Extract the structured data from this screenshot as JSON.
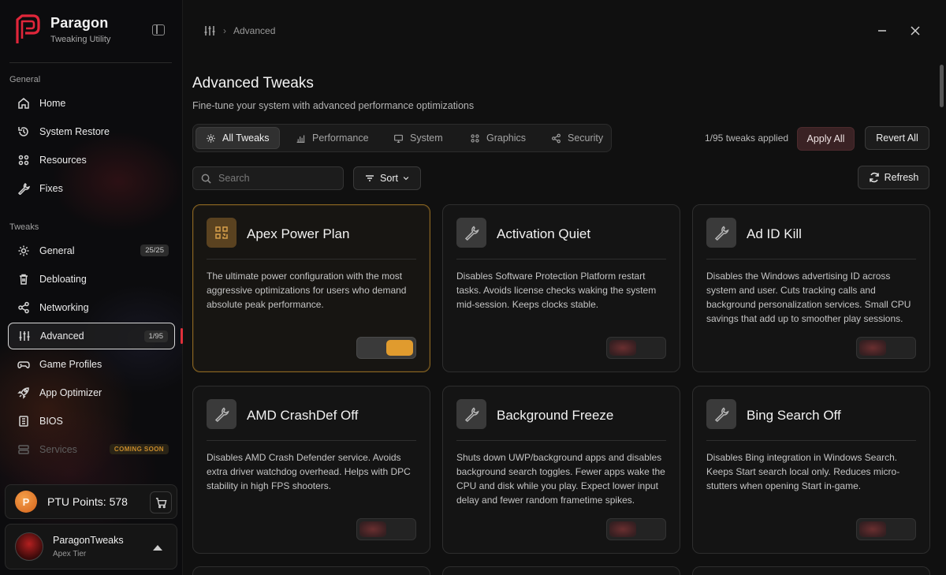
{
  "app": {
    "name": "Paragon",
    "subtitle": "Tweaking Utility"
  },
  "sidebar": {
    "section_general": "General",
    "section_tweaks": "Tweaks",
    "general_items": [
      {
        "label": "Home",
        "icon": "home-icon"
      },
      {
        "label": "System Restore",
        "icon": "restore-icon"
      },
      {
        "label": "Resources",
        "icon": "grid-icon"
      },
      {
        "label": "Fixes",
        "icon": "wrench-icon"
      }
    ],
    "tweak_items": [
      {
        "label": "General",
        "icon": "gear-icon",
        "badge": "25/25"
      },
      {
        "label": "Debloating",
        "icon": "trash-icon"
      },
      {
        "label": "Networking",
        "icon": "share-icon"
      },
      {
        "label": "Advanced",
        "icon": "sliders-icon",
        "badge": "1/95",
        "active": true
      },
      {
        "label": "Game Profiles",
        "icon": "gamepad-icon"
      },
      {
        "label": "App Optimizer",
        "icon": "rocket-icon"
      },
      {
        "label": "BIOS",
        "icon": "chip-icon"
      },
      {
        "label": "Services",
        "icon": "services-icon",
        "badge": "COMING SOON",
        "disabled": true
      }
    ],
    "points_label": "PTU Points: 578",
    "coin_letter": "P",
    "user": {
      "name": "ParagonTweaks",
      "tier": "Apex Tier"
    }
  },
  "breadcrumb": {
    "current": "Advanced",
    "separator": "›"
  },
  "header": {
    "title": "Advanced Tweaks",
    "subtitle": "Fine-tune your system with advanced performance optimizations"
  },
  "tabs": [
    {
      "label": "All Tweaks",
      "icon": "gear-icon",
      "active": true
    },
    {
      "label": "Performance",
      "icon": "bar-chart-icon"
    },
    {
      "label": "System",
      "icon": "monitor-icon"
    },
    {
      "label": "Graphics",
      "icon": "grid-icon"
    },
    {
      "label": "Security",
      "icon": "share-icon"
    }
  ],
  "toolbar": {
    "applied_text": "1/95 tweaks applied",
    "apply_all": "Apply All",
    "revert_all": "Revert All",
    "search_placeholder": "Search",
    "sort_label": "Sort",
    "refresh_label": "Refresh"
  },
  "cards": [
    {
      "title": "Apex Power Plan",
      "icon": "qr-grid-icon",
      "featured": true,
      "enabled": true,
      "description": "The ultimate power configuration with the most aggressive optimizations for users who demand absolute peak performance."
    },
    {
      "title": "Activation Quiet",
      "icon": "wrench-icon",
      "enabled": false,
      "description": "Disables Software Protection Platform restart tasks. Avoids license checks waking the system mid-session. Keeps clocks stable."
    },
    {
      "title": "Ad ID Kill",
      "icon": "wrench-icon",
      "enabled": false,
      "description": "Disables the Windows advertising ID across system and user. Cuts tracking calls and background personalization services. Small CPU savings that add up to smoother play sessions."
    },
    {
      "title": "AMD CrashDef Off",
      "icon": "wrench-icon",
      "enabled": false,
      "description": "Disables AMD Crash Defender service. Avoids extra driver watchdog overhead. Helps with DPC stability in high FPS shooters."
    },
    {
      "title": "Background Freeze",
      "icon": "wrench-icon",
      "enabled": false,
      "description": "Shuts down UWP/background apps and disables background search toggles. Fewer apps wake the CPU and disk while you play. Expect lower input delay and fewer random frametime spikes."
    },
    {
      "title": "Bing Search Off",
      "icon": "wrench-icon",
      "enabled": false,
      "description": "Disables Bing integration in Windows Search. Keeps Start search local only. Reduces micro-stutters when opening Start in-game."
    }
  ]
}
